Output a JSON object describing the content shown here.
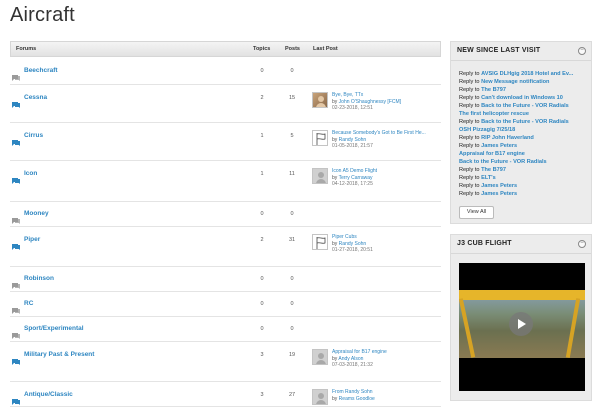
{
  "page": {
    "title": "Aircraft"
  },
  "forums": {
    "headers": {
      "forums": "Forums",
      "topics": "Topics",
      "posts": "Posts",
      "last_post": "Last Post"
    },
    "rows": [
      {
        "name": "Beechcraft",
        "topics": "0",
        "posts": "0"
      },
      {
        "name": "Cessna",
        "topics": "2",
        "posts": "15",
        "last": {
          "title": "Bye, Bye, TTx",
          "by": "by",
          "author": "John O'Shaughnessy [FCM]",
          "date": "02-23-2018, 12:51"
        }
      },
      {
        "name": "Cirrus",
        "topics": "1",
        "posts": "5",
        "last": {
          "title": "Because Somebody's Got to Be First He...",
          "by": "by",
          "author": "Randy Sohn",
          "date": "01-05-2018, 21:57"
        }
      },
      {
        "name": "Icon",
        "topics": "1",
        "posts": "11",
        "last": {
          "title": "Icon A5 Demo Flight",
          "by": "by",
          "author": "Terry Carraway",
          "date": "04-12-2018, 17:25"
        }
      },
      {
        "name": "Mooney",
        "topics": "0",
        "posts": "0"
      },
      {
        "name": "Piper",
        "topics": "2",
        "posts": "31",
        "last": {
          "title": "Piper Cubs",
          "by": "by",
          "author": "Randy Sohn",
          "date": "01-27-2018, 20:51"
        }
      },
      {
        "name": "Robinson",
        "topics": "0",
        "posts": "0"
      },
      {
        "name": "RC",
        "topics": "0",
        "posts": "0"
      },
      {
        "name": "Sport/Experimental",
        "topics": "0",
        "posts": "0"
      },
      {
        "name": "Military Past & Present",
        "topics": "3",
        "posts": "19",
        "last": {
          "title": "Appraisal for B17 engine",
          "by": "by",
          "author": "Andy Alson",
          "date": "07-03-2018, 21:32"
        }
      },
      {
        "name": "Antique/Classic",
        "topics": "3",
        "posts": "27",
        "last": {
          "title": "From Randy Sohn",
          "by": "by",
          "author": "Reams Goodloe",
          "date": ""
        }
      }
    ]
  },
  "sidebar": {
    "new_since": {
      "title": "NEW SINCE LAST VISIT",
      "collapse_icon": "−",
      "items": [
        {
          "prefix": "Reply to",
          "link": "AVSIG DLHgig 2018 Hotel and Ev..."
        },
        {
          "prefix": "Reply to",
          "link": "New Message notification"
        },
        {
          "prefix": "Reply to",
          "link": "The B797"
        },
        {
          "prefix": "Reply to",
          "link": "Can't download in Windows 10"
        },
        {
          "prefix": "Reply to",
          "link": "Back to the Future - VOR Radials"
        },
        {
          "prefix": "",
          "link": "The first helicopter rescue"
        },
        {
          "prefix": "Reply to",
          "link": "Back to the Future - VOR Radials"
        },
        {
          "prefix": "",
          "link": "OSH Pizzagig 7/25/18"
        },
        {
          "prefix": "Reply to",
          "link": "RIP John Haverland"
        },
        {
          "prefix": "Reply to",
          "link": "James Peters"
        },
        {
          "prefix": "",
          "link": "Appraisal for B17 engine"
        },
        {
          "prefix": "",
          "link": "Back to the Future - VOR Radials"
        },
        {
          "prefix": "Reply to",
          "link": "The B797"
        },
        {
          "prefix": "Reply to",
          "link": "ELT's"
        },
        {
          "prefix": "Reply to",
          "link": "James Peters"
        },
        {
          "prefix": "Reply to",
          "link": "James Peters"
        }
      ],
      "view_all": "View All"
    },
    "video": {
      "title": "J3 CUB FLIGHT",
      "collapse_icon": "−"
    }
  }
}
